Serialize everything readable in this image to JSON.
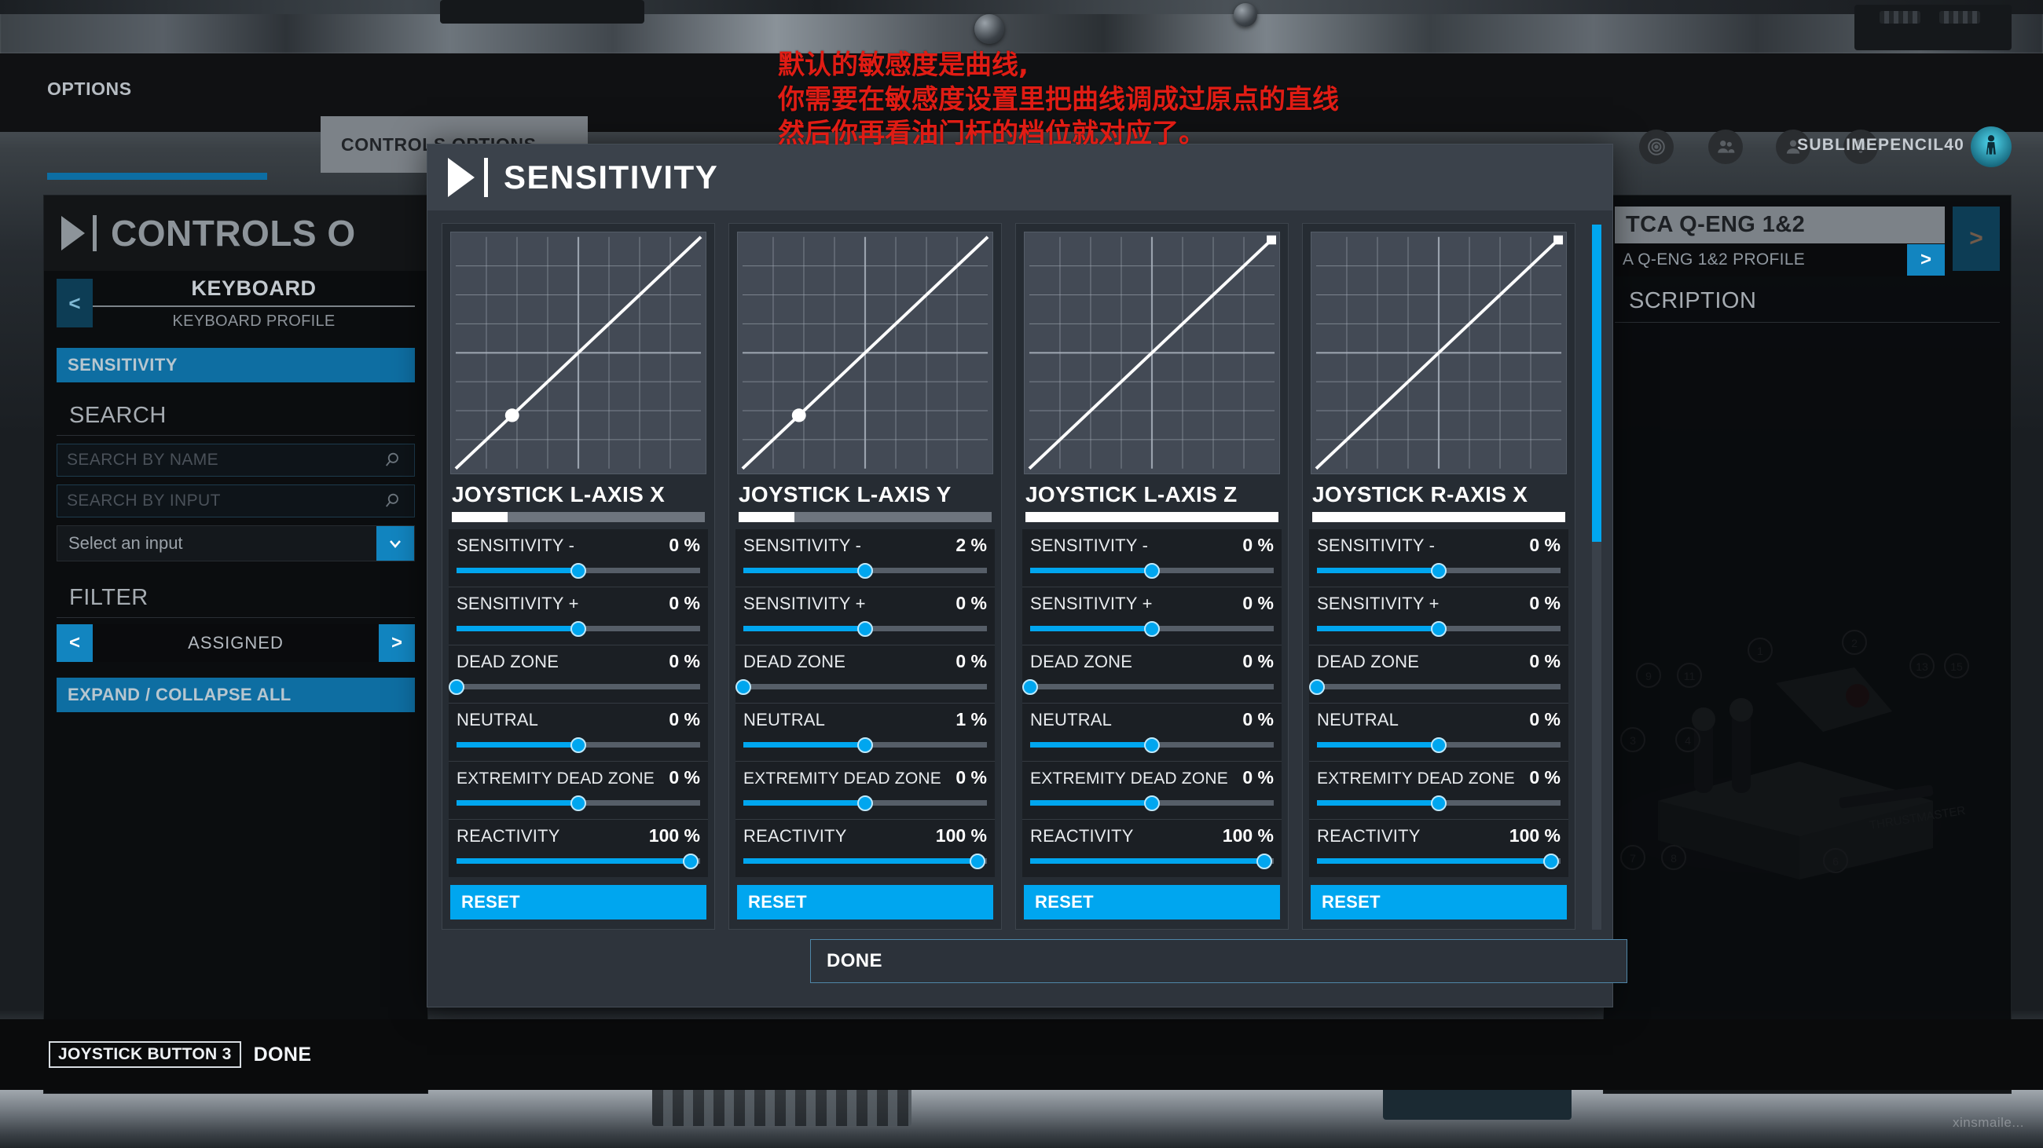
{
  "topbar": {
    "tabs": [
      {
        "label": "OPTIONS",
        "active": true
      },
      {
        "label": "CONTROLS OPTIONS",
        "active": false
      }
    ],
    "icons": [
      "radar-icon",
      "friends-icon",
      "profile-icon",
      "bell-icon"
    ],
    "username": "SUBLIMEPENCIL40",
    "avatar": "pilot-avatar"
  },
  "annotation": {
    "line1": "默认的敏感度是曲线,",
    "line2": "你需要在敏感度设置里把曲线调成过原点的直线",
    "line3": "然后你再看油门杆的档位就对应了。",
    "color": "#e01c14"
  },
  "left_pane": {
    "title": "CONTROLS O",
    "profile_name": "KEYBOARD",
    "profile_sub": "KEYBOARD PROFILE",
    "prev_arrow": "<",
    "sensitivity_button": "SENSITIVITY",
    "search_section": "SEARCH",
    "search_by_name_placeholder": "SEARCH BY NAME",
    "search_by_input_placeholder": "SEARCH BY INPUT",
    "select_input_value": "Select an input",
    "filter_section": "FILTER",
    "filter_prev": "<",
    "filter_value": "ASSIGNED",
    "filter_next": ">",
    "expand_collapse": "EXPAND / COLLAPSE ALL"
  },
  "right_pane": {
    "device_name": "TCA Q-ENG 1&2",
    "device_profile": "A Q-ENG 1&2 PROFILE",
    "profile_next": ">",
    "device_next": ">",
    "description_label": "SCRIPTION"
  },
  "modal": {
    "title": "SENSITIVITY",
    "done_label": "DONE",
    "reset_label": "RESET",
    "scrollbar": {
      "thumb_top_pct": 0,
      "thumb_height_pct": 45
    }
  },
  "hintbar": {
    "key": "JOYSTICK BUTTON 3",
    "action": "DONE"
  },
  "watermark": "xinsmaile...",
  "chart_data": [
    {
      "type": "line",
      "title": "JOYSTICK L-AXIS X",
      "xlim": [
        0,
        1
      ],
      "ylim": [
        0,
        1
      ],
      "grid": true,
      "x": [
        0,
        1
      ],
      "y": [
        0,
        1
      ],
      "marker": {
        "shape": "circle",
        "x": 0.23,
        "y": 0.23
      },
      "meter_pct": 22
    },
    {
      "type": "line",
      "title": "JOYSTICK L-AXIS Y",
      "xlim": [
        0,
        1
      ],
      "ylim": [
        0,
        1
      ],
      "grid": true,
      "x": [
        0,
        1
      ],
      "y": [
        0,
        1
      ],
      "marker": {
        "shape": "circle",
        "x": 0.23,
        "y": 0.23
      },
      "meter_pct": 22
    },
    {
      "type": "line",
      "title": "JOYSTICK L-AXIS Z",
      "xlim": [
        0,
        1
      ],
      "ylim": [
        0,
        1
      ],
      "grid": true,
      "x": [
        0,
        1
      ],
      "y": [
        0,
        1
      ],
      "marker": {
        "shape": "square",
        "x": 1.0,
        "y": 1.0
      },
      "meter_pct": 100
    },
    {
      "type": "line",
      "title": "JOYSTICK R-AXIS X",
      "xlim": [
        0,
        1
      ],
      "ylim": [
        0,
        1
      ],
      "grid": true,
      "x": [
        0,
        1
      ],
      "y": [
        0,
        1
      ],
      "marker": {
        "shape": "square",
        "x": 1.0,
        "y": 1.0
      },
      "meter_pct": 100
    }
  ],
  "axes": [
    {
      "title": "JOYSTICK L-AXIS X",
      "meter_pct": 22,
      "sliders": [
        {
          "label": "SENSITIVITY -",
          "value": "0 %",
          "pct": 50
        },
        {
          "label": "SENSITIVITY +",
          "value": "0 %",
          "pct": 50
        },
        {
          "label": "DEAD ZONE",
          "value": "0 %",
          "pct": 0
        },
        {
          "label": "NEUTRAL",
          "value": "0 %",
          "pct": 50
        },
        {
          "label": "EXTREMITY DEAD ZONE",
          "value": "0 %",
          "pct": 50
        },
        {
          "label": "REACTIVITY",
          "value": "100 %",
          "pct": 96
        }
      ]
    },
    {
      "title": "JOYSTICK L-AXIS Y",
      "meter_pct": 22,
      "sliders": [
        {
          "label": "SENSITIVITY -",
          "value": "2 %",
          "pct": 50
        },
        {
          "label": "SENSITIVITY +",
          "value": "0 %",
          "pct": 50
        },
        {
          "label": "DEAD ZONE",
          "value": "0 %",
          "pct": 0
        },
        {
          "label": "NEUTRAL",
          "value": "1 %",
          "pct": 50
        },
        {
          "label": "EXTREMITY DEAD ZONE",
          "value": "0 %",
          "pct": 50
        },
        {
          "label": "REACTIVITY",
          "value": "100 %",
          "pct": 96
        }
      ]
    },
    {
      "title": "JOYSTICK L-AXIS Z",
      "meter_pct": 100,
      "sliders": [
        {
          "label": "SENSITIVITY -",
          "value": "0 %",
          "pct": 50
        },
        {
          "label": "SENSITIVITY +",
          "value": "0 %",
          "pct": 50
        },
        {
          "label": "DEAD ZONE",
          "value": "0 %",
          "pct": 0
        },
        {
          "label": "NEUTRAL",
          "value": "0 %",
          "pct": 50
        },
        {
          "label": "EXTREMITY DEAD ZONE",
          "value": "0 %",
          "pct": 50
        },
        {
          "label": "REACTIVITY",
          "value": "100 %",
          "pct": 96
        }
      ]
    },
    {
      "title": "JOYSTICK R-AXIS X",
      "meter_pct": 100,
      "sliders": [
        {
          "label": "SENSITIVITY -",
          "value": "0 %",
          "pct": 50
        },
        {
          "label": "SENSITIVITY +",
          "value": "0 %",
          "pct": 50
        },
        {
          "label": "DEAD ZONE",
          "value": "0 %",
          "pct": 0
        },
        {
          "label": "NEUTRAL",
          "value": "0 %",
          "pct": 50
        },
        {
          "label": "EXTREMITY DEAD ZONE",
          "value": "0 %",
          "pct": 50
        },
        {
          "label": "REACTIVITY",
          "value": "100 %",
          "pct": 96
        }
      ]
    }
  ],
  "colors": {
    "accent": "#00a6ef",
    "accent_dark": "#0e6ea2",
    "panel": "#2e343c",
    "graph_bg": "#434a55",
    "annotation": "#e01c14"
  }
}
